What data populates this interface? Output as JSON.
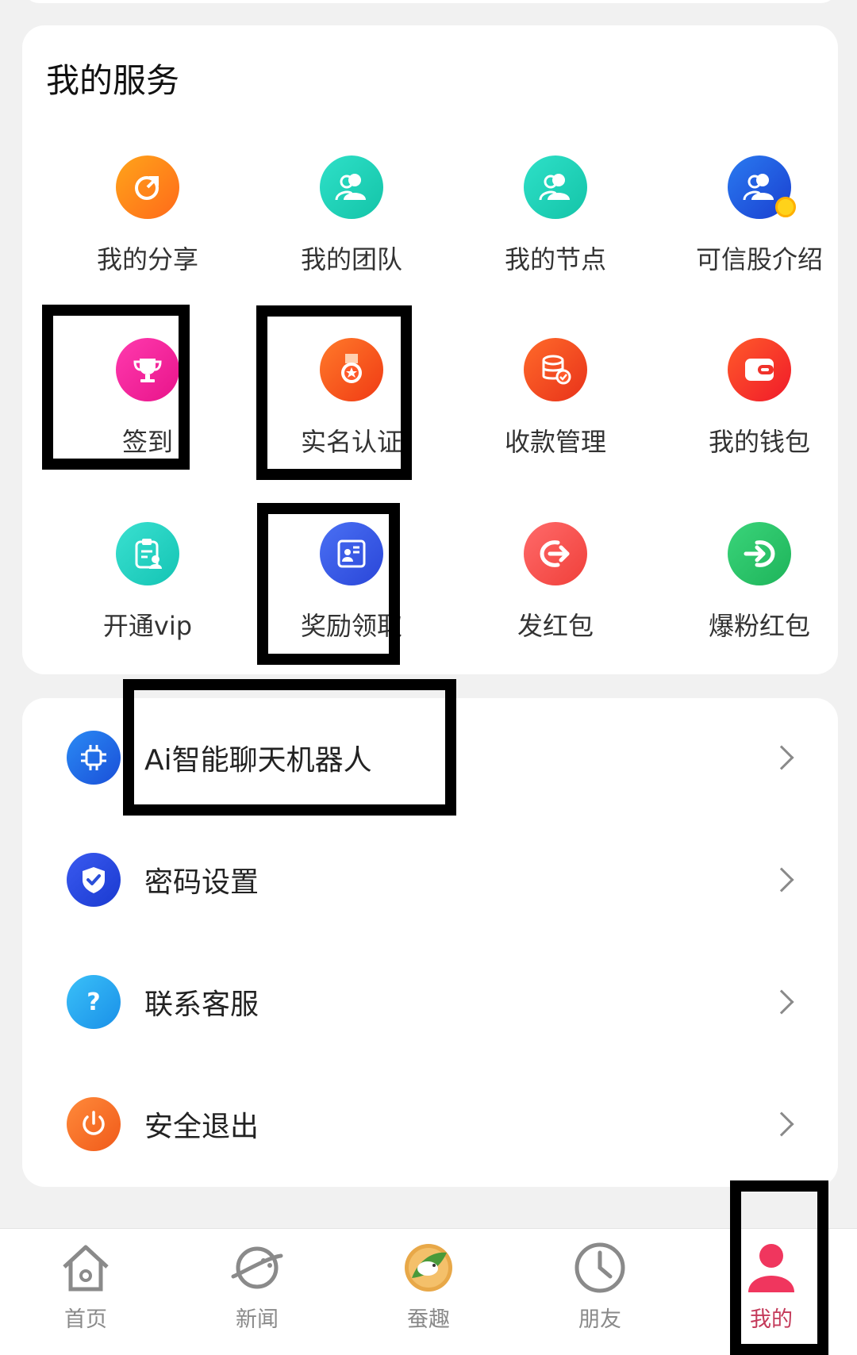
{
  "services": {
    "title": "我的服务",
    "items": [
      {
        "label": "我的分享",
        "icon": "share-icon",
        "color": "#ff7a1a"
      },
      {
        "label": "我的团队",
        "icon": "team-icon",
        "color": "#1fd4b8"
      },
      {
        "label": "我的节点",
        "icon": "node-icon",
        "color": "#1fd4b8"
      },
      {
        "label": "可信股介绍",
        "icon": "trusted-share-icon",
        "color": "#1e5be6"
      },
      {
        "label": "签到",
        "icon": "trophy-icon",
        "color": "#f0249b"
      },
      {
        "label": "实名认证",
        "icon": "medal-icon",
        "color": "#ff5a1f"
      },
      {
        "label": "收款管理",
        "icon": "coins-icon",
        "color": "#ff4a1f"
      },
      {
        "label": "我的钱包",
        "icon": "wallet-icon",
        "color": "#ff3a2a"
      },
      {
        "label": "开通vip",
        "icon": "vip-clipboard-icon",
        "color": "#22d4c4"
      },
      {
        "label": "奖励领取",
        "icon": "id-card-icon",
        "color": "#3d5ee8"
      },
      {
        "label": "发红包",
        "icon": "send-envelope-icon",
        "color": "#ff5a5a"
      },
      {
        "label": "爆粉红包",
        "icon": "enter-arrow-icon",
        "color": "#2ec46a"
      }
    ]
  },
  "menu": [
    {
      "label": "Ai智能聊天机器人",
      "icon": "chip-icon",
      "color": "#1a6ee8"
    },
    {
      "label": "密码设置",
      "icon": "shield-check-icon",
      "color": "#2a4fd8"
    },
    {
      "label": "联系客服",
      "icon": "help-bubble-icon",
      "color": "#1aa8f0"
    },
    {
      "label": "安全退出",
      "icon": "power-icon",
      "color": "#ff6a2a"
    }
  ],
  "tabbar": [
    {
      "label": "首页",
      "icon": "home-icon"
    },
    {
      "label": "新闻",
      "icon": "planet-icon"
    },
    {
      "label": "蚕趣",
      "icon": "silkworm-icon"
    },
    {
      "label": "朋友",
      "icon": "clock-icon"
    },
    {
      "label": "我的",
      "icon": "person-icon",
      "active": true
    }
  ],
  "colors": {
    "accent": "#f0365e",
    "active_tab_text": "#c43a5a"
  }
}
